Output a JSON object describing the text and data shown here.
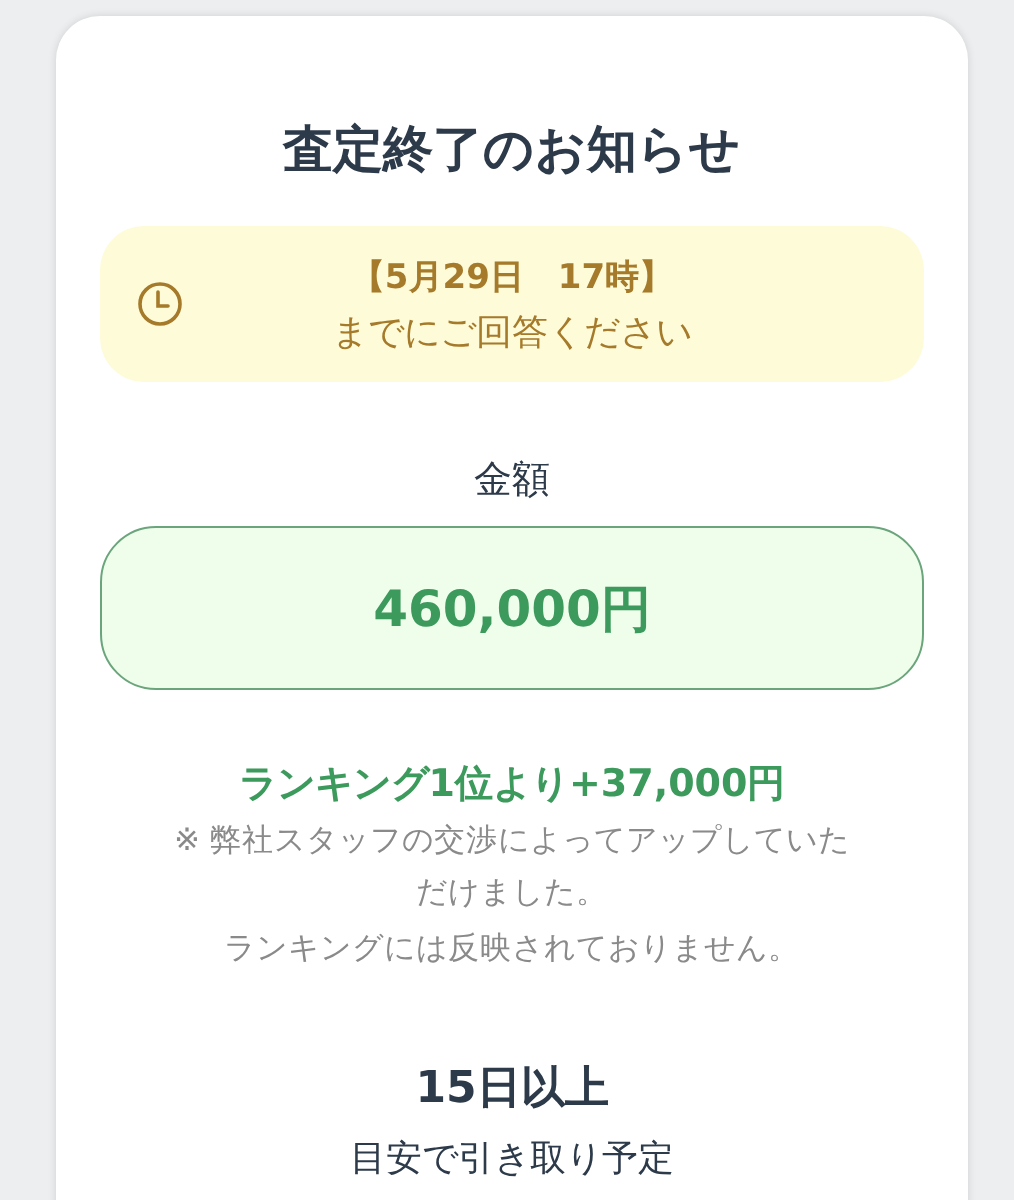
{
  "title": "査定終了のお知らせ",
  "deadline": {
    "date": "【5月29日　17時】",
    "text": "までにご回答ください"
  },
  "amount": {
    "label": "金額",
    "value": "460,000円"
  },
  "bonus": "ランキング1位より+37,000円",
  "notes": [
    "※ 弊社スタッフの交渉によってアップしていただけました。",
    "ランキングには反映されておりません。"
  ],
  "pickup": {
    "value": "15日以上",
    "text": "目安で引き取り予定"
  }
}
